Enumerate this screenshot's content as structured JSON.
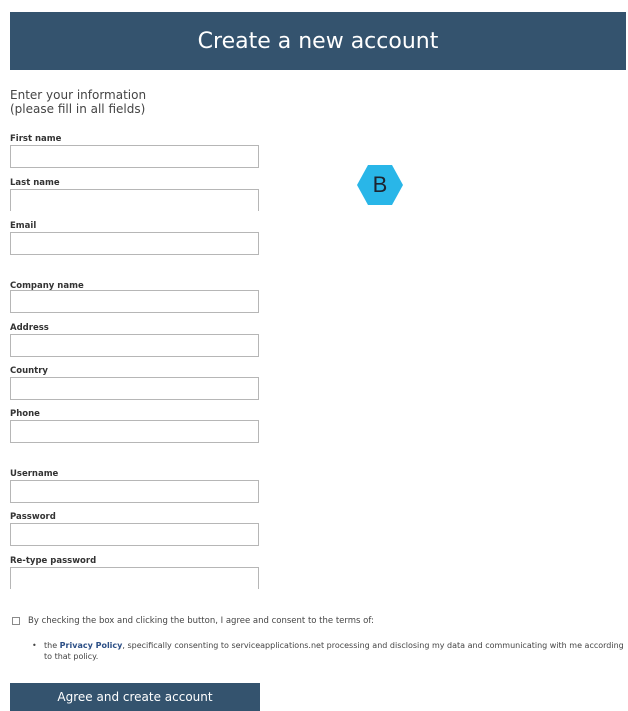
{
  "header": {
    "title": "Create a new account"
  },
  "intro": {
    "line1": "Enter your information",
    "line2": "(please fill in all fields)"
  },
  "fields": [
    {
      "label": "First name",
      "value": ""
    },
    {
      "label": "Last name",
      "value": ""
    },
    {
      "label": "Email",
      "value": ""
    },
    {
      "label": "Company name",
      "value": ""
    },
    {
      "label": "Address",
      "value": ""
    },
    {
      "label": "Country",
      "value": ""
    },
    {
      "label": "Phone",
      "value": ""
    },
    {
      "label": "Username",
      "value": ""
    },
    {
      "label": "Password",
      "value": ""
    },
    {
      "label": "Re-type password",
      "value": ""
    }
  ],
  "badge": {
    "letter": "B",
    "color": "#29b6e8"
  },
  "consent": {
    "checked": false,
    "text": "By checking the box and clicking the button, I agree and consent to the terms of:",
    "bullet": "•",
    "policy_prefix": "the ",
    "policy_link": "Privacy Policy",
    "policy_suffix": ", specifically consenting to serviceapplications.net processing and disclosing my data and communicating with me according to that policy."
  },
  "submit": {
    "label": "Agree and create account"
  },
  "colors": {
    "header_bg": "#34536e",
    "button_bg": "#34536e",
    "link": "#2c4f86"
  }
}
